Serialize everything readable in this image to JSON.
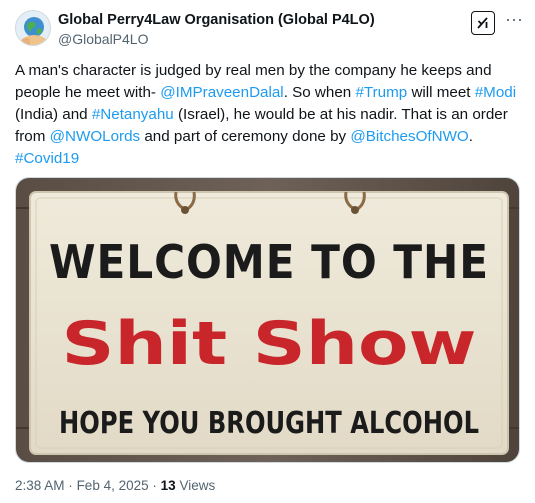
{
  "author": {
    "name": "Global Perry4Law Organisation (Global P4LO)",
    "handle": "@GlobalP4LO"
  },
  "header": {
    "grok_icon": "grok-icon",
    "more_icon": "more-icon",
    "more_label": "···"
  },
  "tweet": {
    "segments": [
      {
        "text": "A man's character is judged by real men by the company he keeps and people he meet with- ",
        "link": false
      },
      {
        "text": "@IMPraveenDalal",
        "link": true
      },
      {
        "text": ". So when ",
        "link": false
      },
      {
        "text": "#Trump",
        "link": true
      },
      {
        "text": " will meet ",
        "link": false
      },
      {
        "text": "#Modi",
        "link": true
      },
      {
        "text": " (India) and ",
        "link": false
      },
      {
        "text": "#Netanyahu",
        "link": true
      },
      {
        "text": " (Israel), he would be at his nadir. That is an order from ",
        "link": false
      },
      {
        "text": "@NWOLords",
        "link": true
      },
      {
        "text": " and part of ceremony done by ",
        "link": false
      },
      {
        "text": "@BitchesOfNWO",
        "link": true
      },
      {
        "text": ". ",
        "link": false
      },
      {
        "text": "#Covid19",
        "link": true
      }
    ]
  },
  "image": {
    "sign_line1": "WELCOME TO THE",
    "sign_line2": "Shit Show",
    "sign_line3": "HOPE YOU BROUGHT ALCOHOL"
  },
  "meta": {
    "time": "2:38 AM",
    "date": "Feb 4, 2025",
    "views_count": "13",
    "views_label": "Views",
    "separator": "·"
  },
  "colors": {
    "link": "#1d9bf0",
    "muted": "#536471",
    "text": "#0f1419",
    "sign_red": "#c8262b"
  }
}
